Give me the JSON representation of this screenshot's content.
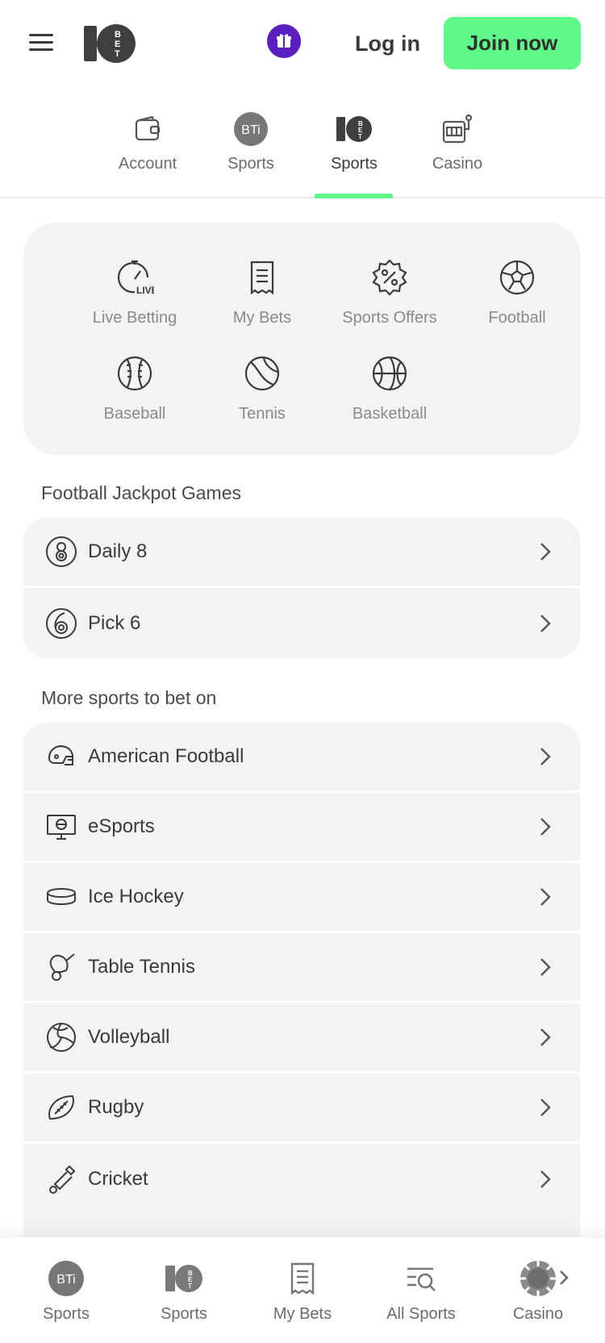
{
  "header": {
    "login_label": "Log in",
    "join_label": "Join now",
    "brand_color": "#5ef788",
    "gift_color": "#5b1fbf"
  },
  "top_tabs": [
    {
      "label": "Account",
      "icon": "wallet-icon"
    },
    {
      "label": "Sports",
      "icon": "bti-icon"
    },
    {
      "label": "Sports",
      "icon": "10bet-icon",
      "active": true
    },
    {
      "label": "Casino",
      "icon": "slot-machine-icon"
    }
  ],
  "quick_links": [
    {
      "label": "Live Betting",
      "icon": "live-stopwatch-icon"
    },
    {
      "label": "My Bets",
      "icon": "receipt-icon"
    },
    {
      "label": "Sports Offers",
      "icon": "percent-badge-icon"
    },
    {
      "label": "Football",
      "icon": "soccer-ball-icon"
    },
    {
      "label": "Baseball",
      "icon": "baseball-icon"
    },
    {
      "label": "Tennis",
      "icon": "tennis-ball-icon"
    },
    {
      "label": "Basketball",
      "icon": "basketball-icon"
    }
  ],
  "jackpot": {
    "title": "Football Jackpot Games",
    "items": [
      {
        "label": "Daily 8",
        "icon": "daily-8-icon"
      },
      {
        "label": "Pick 6",
        "icon": "pick-6-icon"
      }
    ]
  },
  "more_sports": {
    "title": "More sports to bet on",
    "items": [
      {
        "label": "American Football",
        "icon": "helmet-icon"
      },
      {
        "label": "eSports",
        "icon": "monitor-icon"
      },
      {
        "label": "Ice Hockey",
        "icon": "puck-icon"
      },
      {
        "label": "Table Tennis",
        "icon": "paddle-icon"
      },
      {
        "label": "Volleyball",
        "icon": "volleyball-icon"
      },
      {
        "label": "Rugby",
        "icon": "rugby-ball-icon"
      },
      {
        "label": "Cricket",
        "icon": "cricket-bat-icon"
      }
    ]
  },
  "bottom_nav": [
    {
      "label": "Sports",
      "icon": "bti-icon"
    },
    {
      "label": "Sports",
      "icon": "10bet-icon"
    },
    {
      "label": "My Bets",
      "icon": "receipt-icon"
    },
    {
      "label": "All Sports",
      "icon": "search-list-icon"
    },
    {
      "label": "Casino",
      "icon": "chip-icon"
    }
  ]
}
